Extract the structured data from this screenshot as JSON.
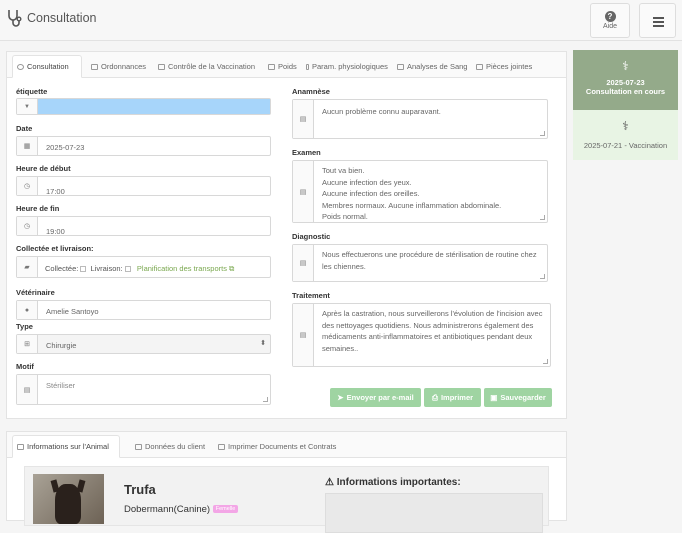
{
  "header": {
    "title": "Consultation",
    "help_label": "Aide"
  },
  "tabs": [
    {
      "label": "Consultation",
      "icon": "stethoscope-icon"
    },
    {
      "label": "Ordonnances",
      "icon": "prescription-icon"
    },
    {
      "label": "Contrôle de la Vaccination",
      "icon": "vaccine-icon"
    },
    {
      "label": "Poids",
      "icon": "weight-chart-icon"
    },
    {
      "label": "Param. physiologiques",
      "icon": "thermometer-icon"
    },
    {
      "label": "Analyses de Sang",
      "icon": "blood-test-icon"
    },
    {
      "label": "Pièces jointes",
      "icon": "attachment-icon"
    }
  ],
  "form": {
    "etiquette_label": "étiquette",
    "etiquette_color": "#a7d5fa",
    "date_label": "Date",
    "date_value": "2025-07-23",
    "start_label": "Heure de début",
    "start_value": "17:00",
    "end_label": "Heure de fin",
    "end_value": "19:00",
    "collect_label": "Collectée et livraison:",
    "collected_label": "Collectée:",
    "delivery_label": "Livraison:",
    "planning_link": "Planification des transports",
    "vet_label": "Vétérinaire",
    "vet_value": "Amelie Santoyo",
    "type_label": "Type",
    "type_value": "Chirurgie",
    "motif_label": "Motif",
    "motif_placeholder": "Stériliser",
    "anamnese_label": "Anamnèse",
    "anamnese_value": "Aucun problème connu auparavant.",
    "examen_label": "Examen",
    "examen_value": "Tout va bien.\nAucune infection des yeux.\nAucune infection des oreilles.\nMembres normaux. Aucune inflammation abdominale.\nPoids normal.",
    "diagnostic_label": "Diagnostic",
    "diagnostic_value": "Nous effectuerons une procédure de stérilisation de routine chez les chiennes.",
    "traitement_label": "Traitement",
    "traitement_value": "Après la castration, nous surveillerons l'évolution de l'incision avec des nettoyages quotidiens. Nous administrerons également des médicaments anti-inflammatoires et antibiotiques pendant deux semaines.."
  },
  "actions": {
    "email": "Envoyer par e-mail",
    "print": "Imprimer",
    "save": "Sauvegarder"
  },
  "sidebar": [
    {
      "date": "2025-07-23",
      "subtitle": "Consultation en cours",
      "active": true
    },
    {
      "date": "2025-07-21",
      "subtitle": "Vaccination",
      "active": false
    }
  ],
  "bottom": {
    "tabs": [
      "Informations sur l'Animal",
      "Données du client",
      "Imprimer Documents et Contrats"
    ],
    "pet_name": "Trufa",
    "breed": "Dobermann(Canine)",
    "sex_badge": "Femelle",
    "important_title": "Informations importantes:"
  },
  "colors": {
    "accent": "#9fd4a2",
    "sidebar_active": "#94aa8a",
    "sidebar_inactive": "#e8f4e4"
  }
}
